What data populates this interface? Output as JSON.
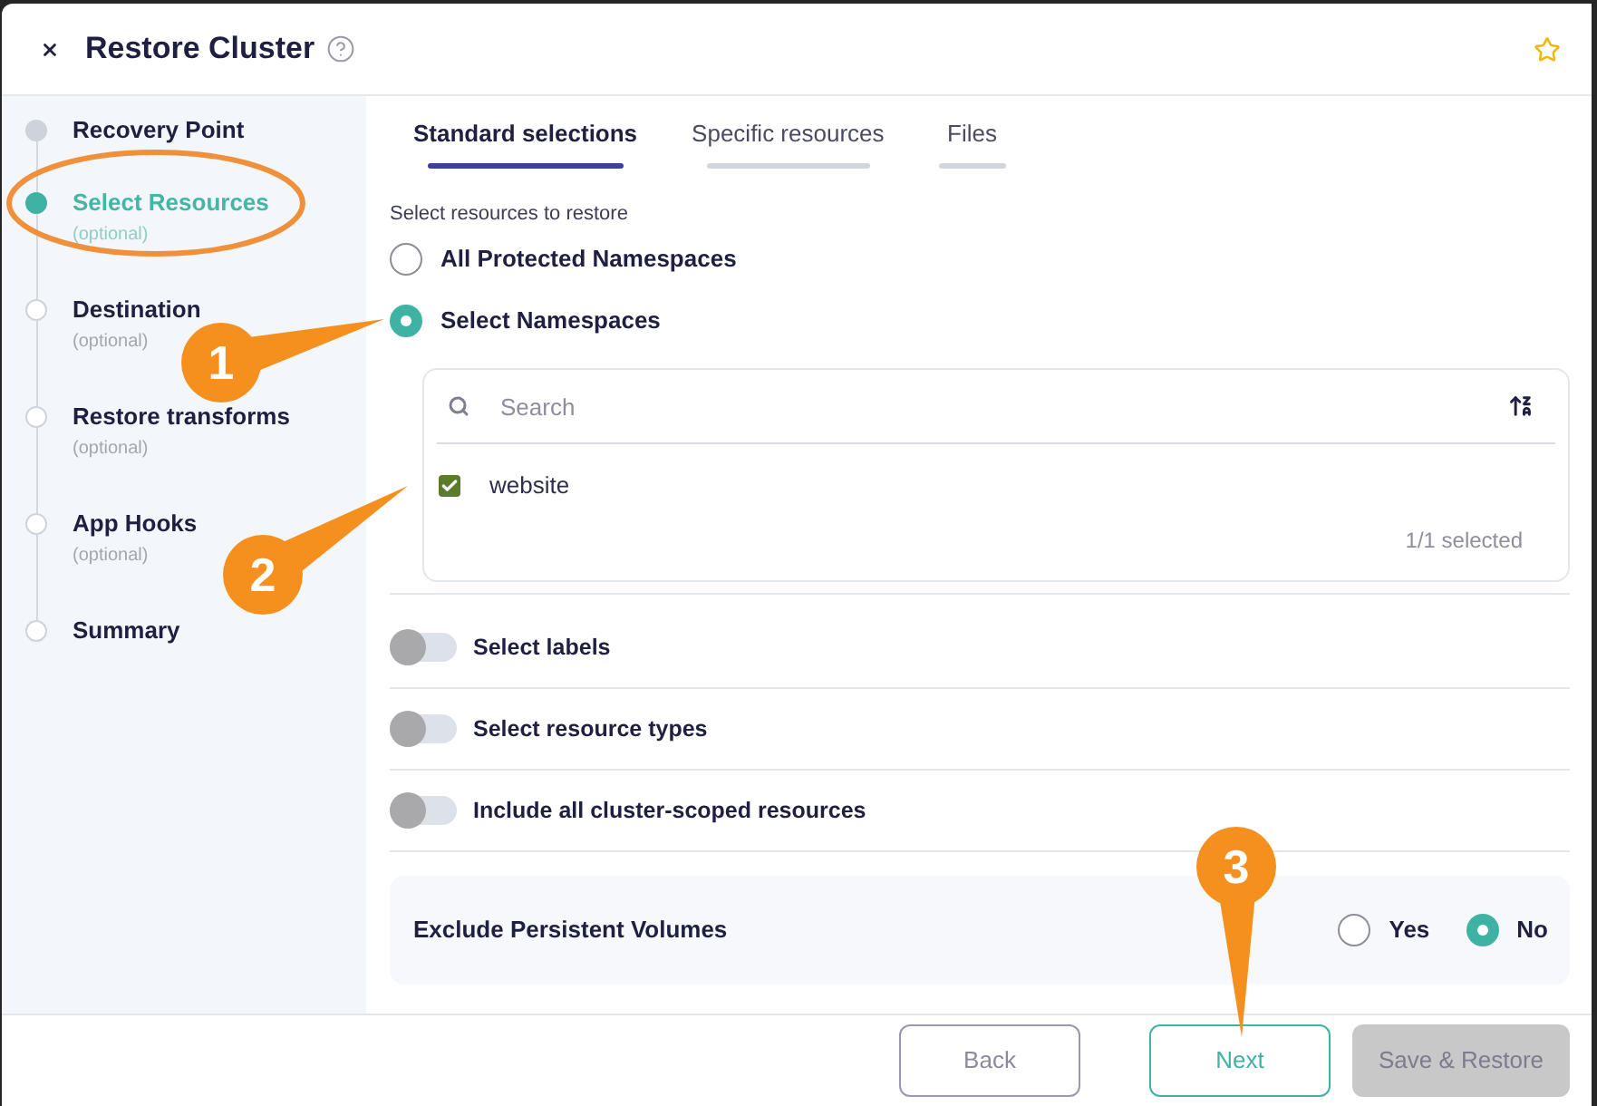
{
  "window": {
    "title": "Restore Cluster"
  },
  "steps": [
    {
      "label": "Recovery Point",
      "completed": true,
      "selected": false
    },
    {
      "label": "Select Resources",
      "hint": "(optional)",
      "completed": false,
      "selected": true
    },
    {
      "label": "Destination",
      "hint": "(optional)",
      "completed": false,
      "selected": false
    },
    {
      "label": "Restore transforms",
      "hint": "(optional)",
      "completed": false,
      "selected": false
    },
    {
      "label": "App Hooks",
      "hint": "(optional)",
      "completed": false,
      "selected": false
    },
    {
      "label": "Summary",
      "completed": false,
      "selected": false
    }
  ],
  "tabs": [
    {
      "label": "Standard selections",
      "selected": true
    },
    {
      "label": "Specific resources",
      "selected": false
    },
    {
      "label": "Files",
      "selected": false
    }
  ],
  "scope": {
    "label": "Select resources to restore",
    "options": [
      {
        "label": "All Protected Namespaces",
        "selected": false
      },
      {
        "label": "Select Namespaces",
        "selected": true
      }
    ]
  },
  "namespaces": {
    "search": {
      "placeholder": "Search"
    },
    "items": [
      {
        "label": "website",
        "checked": true
      }
    ],
    "count": "1/1 selected"
  },
  "toggles": [
    {
      "label": "Select labels",
      "on": false
    },
    {
      "label": "Select resource types",
      "on": false
    },
    {
      "label": "Include all cluster-scoped resources",
      "on": false
    }
  ],
  "exclude_volumes": {
    "label": "Exclude Persistent Volumes",
    "options": [
      {
        "label": "Yes",
        "selected": false
      },
      {
        "label": "No",
        "selected": true
      }
    ]
  },
  "buttons": [
    {
      "label": "Back",
      "kind": "secondary",
      "disabled": false
    },
    {
      "label": "Next",
      "kind": "primary",
      "disabled": false
    },
    {
      "label": "Save & Restore",
      "kind": "submit",
      "disabled": true
    }
  ],
  "annotations": {
    "markers": [
      {
        "label": "1"
      },
      {
        "label": "2"
      },
      {
        "label": "3"
      }
    ]
  }
}
